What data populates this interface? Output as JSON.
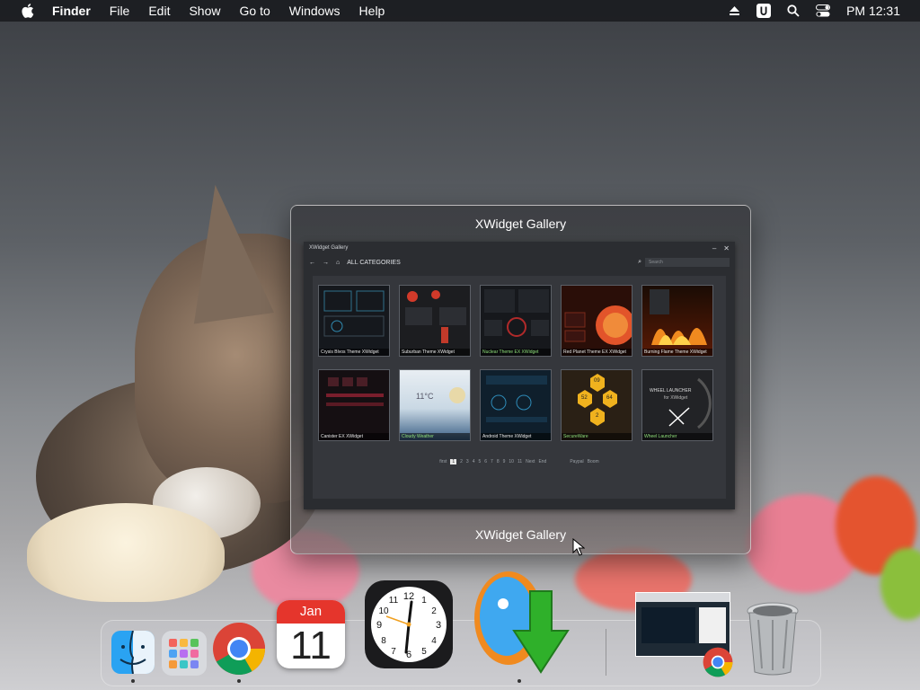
{
  "menubar": {
    "app_name": "Finder",
    "menus": [
      "File",
      "Edit",
      "Show",
      "Go to",
      "Windows",
      "Help"
    ],
    "clock": "PM 12:31"
  },
  "window": {
    "title": "XWidget Gallery",
    "footer_label": "XWidget Gallery"
  },
  "gallery": {
    "app_title": "XWidget Gallery",
    "category": "ALL CATEGORIES",
    "search_placeholder": "Search",
    "tiles": [
      {
        "caption": "Crysis Blvos Theme XWidget",
        "bg": "#15181d",
        "accent": "#2f6f8a",
        "green": false
      },
      {
        "caption": "Suburban Theme XWidget",
        "bg": "#1c1d20",
        "accent": "#d23a2a",
        "green": false
      },
      {
        "caption": "Nuclear Theme EX XWidget",
        "bg": "#16181c",
        "accent": "#b02a2a",
        "green": true
      },
      {
        "caption": "Red Planet Theme EX XWidget",
        "bg": "#2a0e08",
        "accent": "#e2542a",
        "green": false
      },
      {
        "caption": "Burning Flame Theme XWidget",
        "bg": "#1a0c05",
        "accent": "#f08a1f",
        "green": false
      },
      {
        "caption": "Canister EX XWidget",
        "bg": "#150f12",
        "accent": "#7a1e2c",
        "green": false
      },
      {
        "caption": "Cloudy Weather",
        "bg": "#c9d8e4",
        "accent": "#2a5c8c",
        "green": true
      },
      {
        "caption": "Android Theme XWidget",
        "bg": "#0f1f2c",
        "accent": "#2e8bb8",
        "green": false
      },
      {
        "caption": "SecureWare",
        "bg": "#2a2015",
        "accent": "#f0b21e",
        "green": true
      },
      {
        "caption": "Wheel Launcher",
        "bg": "#222326",
        "accent": "#cfcfcf",
        "green": true
      }
    ],
    "tile_texts": {
      "weather_temp": "11°C",
      "hex_values": [
        "09",
        "53",
        "64",
        "52",
        "2"
      ],
      "launcher_title": "WHEEL LAUNCHER",
      "launcher_sub": "for XWidget"
    },
    "pager": {
      "first": "first",
      "pages": [
        "1",
        "2",
        "3",
        "4",
        "5",
        "6",
        "7",
        "8",
        "9",
        "10",
        "11"
      ],
      "active": "1",
      "next": "Next",
      "end": "End",
      "paypal": "Paypal",
      "boom": "Boom"
    }
  },
  "dock": {
    "calendar_month": "Jan",
    "calendar_day": "11",
    "running": [
      "finder",
      "chrome",
      "xwidget"
    ]
  },
  "colors": {
    "menubar_bg": "#14161a",
    "calendar_red": "#e5352c",
    "chrome_red": "#db4437",
    "chrome_green": "#0f9d58",
    "chrome_yellow": "#f4b400",
    "chrome_blue": "#4285f4"
  }
}
